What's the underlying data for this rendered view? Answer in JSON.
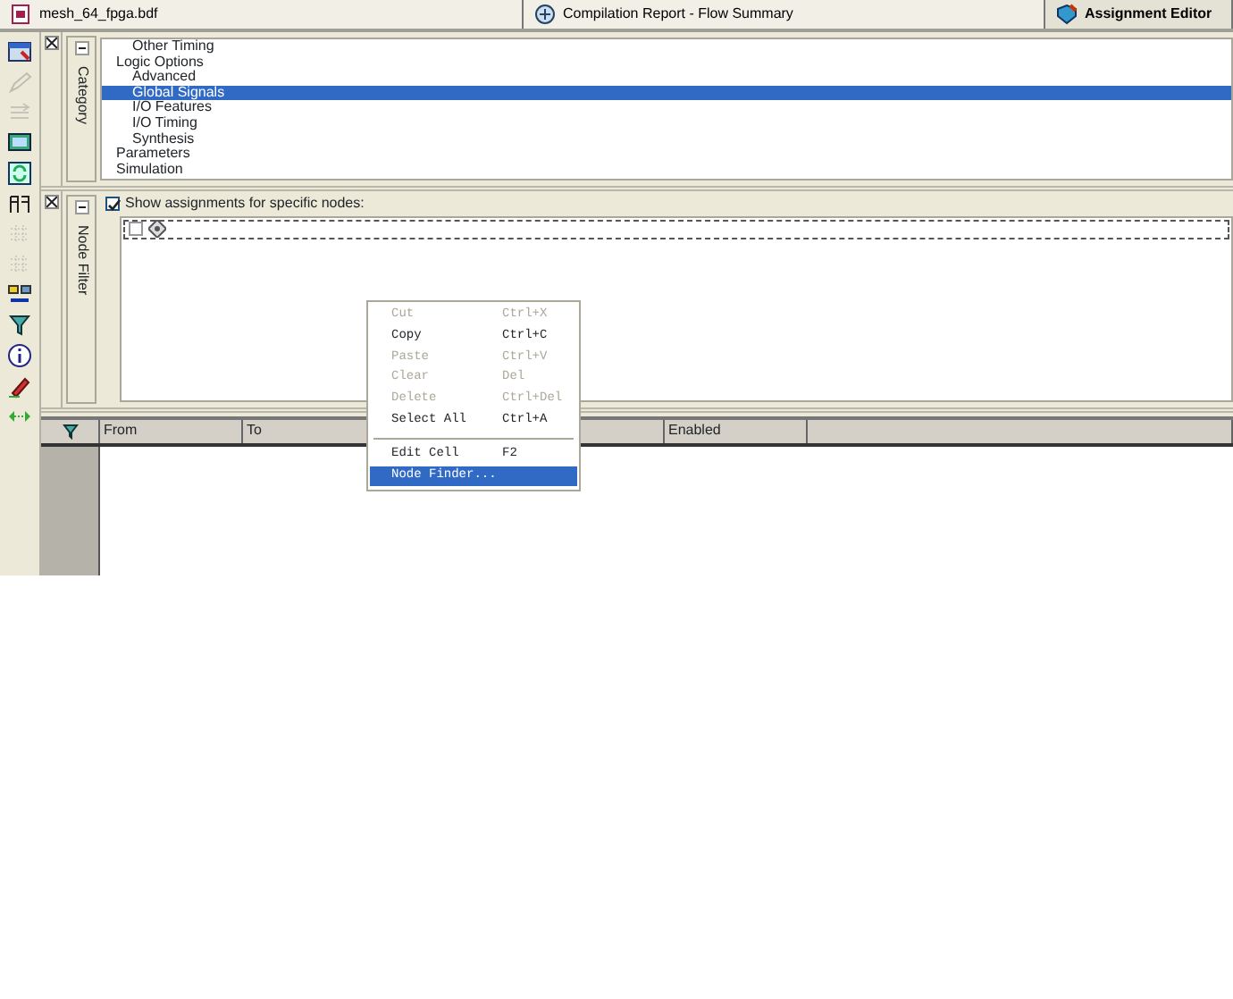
{
  "tabs": [
    {
      "label": "mesh_64_fpga.bdf",
      "kind": "file",
      "selected": false
    },
    {
      "label": "Compilation Report - Flow Summary",
      "kind": "report",
      "selected": false
    },
    {
      "label": "Assignment Editor",
      "kind": "editor",
      "selected": true
    }
  ],
  "toolbar": [
    {
      "kind": "window",
      "disabled": false
    },
    {
      "kind": "pencil",
      "disabled": true
    },
    {
      "kind": "lines",
      "disabled": true
    },
    {
      "kind": "monitor",
      "disabled": false
    },
    {
      "kind": "refresh",
      "disabled": false
    },
    {
      "kind": "pins",
      "disabled": false
    },
    {
      "kind": "grid",
      "disabled": true
    },
    {
      "kind": "grid",
      "disabled": true
    },
    {
      "kind": "nodes",
      "disabled": false
    },
    {
      "kind": "filter",
      "disabled": false
    },
    {
      "kind": "info",
      "disabled": false
    },
    {
      "kind": "pen",
      "disabled": false
    },
    {
      "kind": "arrows",
      "disabled": false
    }
  ],
  "category_panel": {
    "title": "Category",
    "tree_continued": [
      {
        "label": "Other Timing",
        "selected": false
      }
    ],
    "tree": [
      {
        "label": "Logic Options",
        "selected": false,
        "children": [
          {
            "label": "Advanced",
            "selected": false
          },
          {
            "label": "Global Signals",
            "selected": true
          },
          {
            "label": "I/O Features",
            "selected": false
          },
          {
            "label": "I/O Timing",
            "selected": false
          },
          {
            "label": "Synthesis",
            "selected": false
          }
        ]
      },
      {
        "label": "Parameters",
        "selected": false
      },
      {
        "label": "Simulation",
        "selected": false
      }
    ]
  },
  "node_filter_panel": {
    "title": "Node Filter",
    "show_specific": {
      "label": "Show assignments for specific nodes:",
      "checked": true
    },
    "node_row": {
      "checked": false
    }
  },
  "table": {
    "columns": [
      "From",
      "To",
      "Enabled"
    ]
  },
  "context_menu": [
    {
      "kind": "item",
      "label": "Cut",
      "shortcut": "Ctrl+X",
      "disabled": true,
      "selected": false
    },
    {
      "kind": "item",
      "label": "Copy",
      "shortcut": "Ctrl+C",
      "disabled": false,
      "selected": false
    },
    {
      "kind": "item",
      "label": "Paste",
      "shortcut": "Ctrl+V",
      "disabled": true,
      "selected": false
    },
    {
      "kind": "item",
      "label": "Clear",
      "shortcut": "Del",
      "disabled": true,
      "selected": false
    },
    {
      "kind": "item",
      "label": "Delete",
      "shortcut": "Ctrl+Del",
      "disabled": true,
      "selected": false
    },
    {
      "kind": "item",
      "label": "Select All",
      "shortcut": "Ctrl+A",
      "disabled": false,
      "selected": false
    },
    {
      "kind": "separator"
    },
    {
      "kind": "item",
      "label": "Edit Cell",
      "shortcut": "F2",
      "disabled": false,
      "selected": false
    },
    {
      "kind": "item",
      "label": "Node Finder...",
      "disabled": false,
      "selected": true
    }
  ]
}
